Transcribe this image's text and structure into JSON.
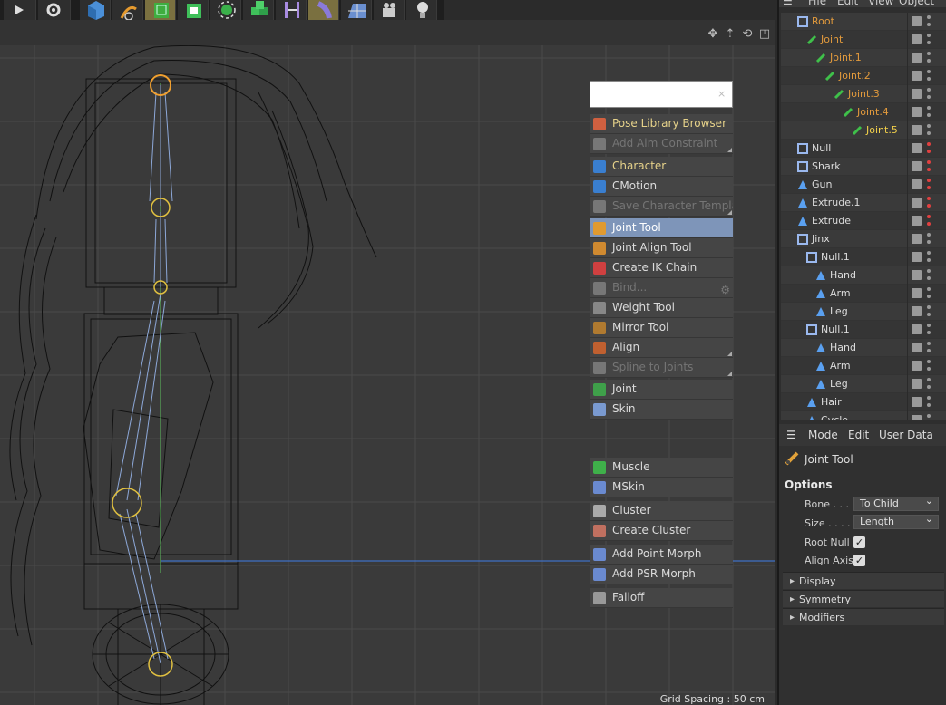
{
  "toolbar": {
    "tools": [
      "play-icon",
      "gear-icon",
      "cube-icon",
      "pen-icon",
      "subdivide-icon",
      "extrude-icon",
      "cloner-icon",
      "boolean-icon",
      "deformer-icon",
      "spline-icon",
      "floor-icon",
      "camera-icon",
      "light-icon"
    ]
  },
  "viewport": {
    "grid_spacing": "Grid Spacing : 50 cm"
  },
  "popup_menu": {
    "groups": [
      {
        "items": [
          {
            "label": "Pose Library Browser",
            "state": "highlight"
          },
          {
            "label": "Add Aim Constraint",
            "state": "disabled"
          }
        ]
      },
      {
        "items": [
          {
            "label": "Character",
            "state": "highlight"
          },
          {
            "label": "CMotion",
            "state": "normal"
          },
          {
            "label": "Save Character Template",
            "state": "disabled"
          }
        ]
      },
      {
        "items": [
          {
            "label": "Joint Tool",
            "state": "active"
          },
          {
            "label": "Joint Align Tool",
            "state": "normal"
          },
          {
            "label": "Create IK Chain",
            "state": "normal"
          },
          {
            "label": "Bind...",
            "state": "disabled"
          },
          {
            "label": "Weight Tool",
            "state": "normal"
          },
          {
            "label": "Mirror Tool",
            "state": "normal"
          },
          {
            "label": "Align",
            "state": "normal"
          },
          {
            "label": "Spline to Joints",
            "state": "disabled"
          }
        ]
      },
      {
        "items": [
          {
            "label": "Joint",
            "state": "normal"
          },
          {
            "label": "Skin",
            "state": "normal"
          }
        ]
      },
      {
        "items": [
          {
            "label": "Muscle",
            "state": "normal"
          },
          {
            "label": "MSkin",
            "state": "normal"
          }
        ]
      },
      {
        "items": [
          {
            "label": "Cluster",
            "state": "normal"
          },
          {
            "label": "Create Cluster",
            "state": "normal"
          }
        ]
      },
      {
        "items": [
          {
            "label": "Add Point Morph",
            "state": "normal"
          },
          {
            "label": "Add PSR Morph",
            "state": "normal"
          }
        ]
      },
      {
        "items": [
          {
            "label": "Falloff",
            "state": "normal"
          }
        ]
      }
    ]
  },
  "object_manager": {
    "menu": [
      "File",
      "Edit",
      "View",
      "Object"
    ],
    "objects": [
      {
        "name": "Root",
        "type": "null",
        "color": "orange"
      },
      {
        "name": "Joint",
        "type": "joint",
        "color": "orange"
      },
      {
        "name": "Joint.1",
        "type": "joint",
        "color": "orange"
      },
      {
        "name": "Joint.2",
        "type": "joint",
        "color": "orange"
      },
      {
        "name": "Joint.3",
        "type": "joint",
        "color": "orange"
      },
      {
        "name": "Joint.4",
        "type": "joint",
        "color": "orange"
      },
      {
        "name": "Joint.5",
        "type": "joint",
        "color": "yellow"
      },
      {
        "name": "Null",
        "type": "null",
        "color": "white"
      },
      {
        "name": "Shark",
        "type": "null",
        "color": "white"
      },
      {
        "name": "Gun",
        "type": "poly",
        "color": "white"
      },
      {
        "name": "Extrude.1",
        "type": "poly",
        "color": "white"
      },
      {
        "name": "Extrude",
        "type": "poly",
        "color": "white"
      },
      {
        "name": "Jinx",
        "type": "null",
        "color": "white"
      },
      {
        "name": "Null.1",
        "type": "null",
        "color": "white"
      },
      {
        "name": "Hand",
        "type": "poly",
        "color": "white"
      },
      {
        "name": "Arm",
        "type": "poly",
        "color": "white"
      },
      {
        "name": "Leg",
        "type": "poly",
        "color": "white"
      },
      {
        "name": "Null.1",
        "type": "null",
        "color": "white"
      },
      {
        "name": "Hand",
        "type": "poly",
        "color": "white"
      },
      {
        "name": "Arm",
        "type": "poly",
        "color": "white"
      },
      {
        "name": "Leg",
        "type": "poly",
        "color": "white"
      },
      {
        "name": "Hair",
        "type": "poly",
        "color": "white"
      },
      {
        "name": "Cycle",
        "type": "poly",
        "color": "white"
      }
    ]
  },
  "attributes": {
    "menu": [
      "Mode",
      "Edit",
      "User Data"
    ],
    "title": "Joint Tool",
    "options_label": "Options",
    "bone_label": "Bone . . .",
    "bone_value": "To Child",
    "size_label": "Size . . . .",
    "size_value": "Length",
    "root_null_label": "Root Null",
    "align_axis_label": "Align Axis",
    "check": "✓",
    "sections": [
      "Display",
      "Symmetry",
      "Modifiers"
    ]
  },
  "colors": {
    "accent": "#7e95b9",
    "orange_text": "#e29a3c",
    "selected_text": "#f2d04a"
  }
}
